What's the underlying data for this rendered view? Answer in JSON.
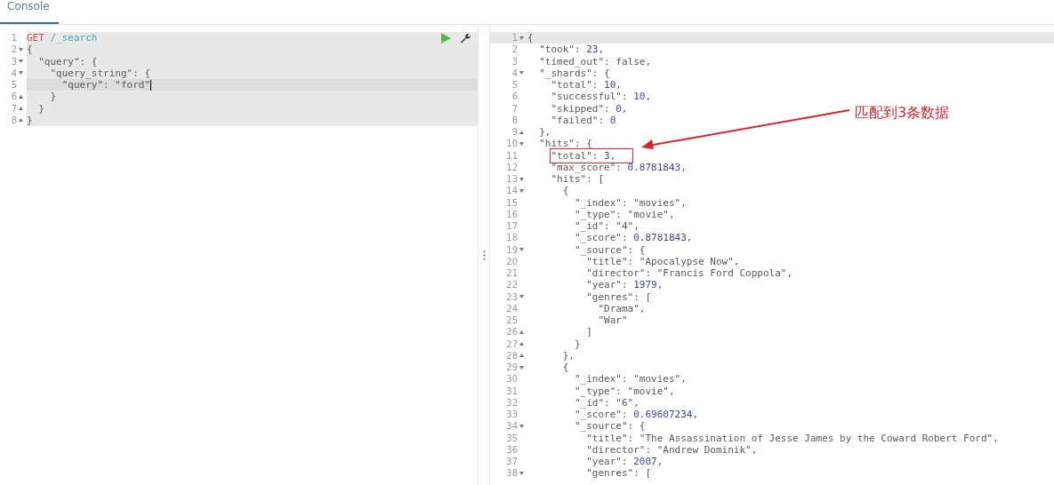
{
  "tabs": [
    {
      "label": "Console",
      "selected": true
    }
  ],
  "request": {
    "lines": [
      {
        "number": "1",
        "kind": "request",
        "method": "GET",
        "path": "/_search",
        "fold_start": false,
        "fold_end": false,
        "active": false
      },
      {
        "number": "2",
        "text": "{",
        "fold_start": true,
        "fold_end": false,
        "active": false
      },
      {
        "number": "3",
        "text": "  \"query\": {",
        "fold_start": true,
        "fold_end": false,
        "active": false
      },
      {
        "number": "4",
        "text": "    \"query_string\": {",
        "fold_start": true,
        "fold_end": false,
        "active": false
      },
      {
        "number": "5",
        "text": "      \"query\": \"ford\"",
        "fold_start": false,
        "fold_end": false,
        "active": true
      },
      {
        "number": "6",
        "text": "    }",
        "fold_start": false,
        "fold_end": true,
        "active": false
      },
      {
        "number": "7",
        "text": "  }",
        "fold_start": false,
        "fold_end": true,
        "active": false
      },
      {
        "number": "8",
        "text": "}",
        "fold_start": false,
        "fold_end": true,
        "active": false
      }
    ]
  },
  "response": {
    "lines": [
      {
        "number": "1",
        "text": "{",
        "fold_start": true,
        "fold_end": false
      },
      {
        "number": "2",
        "text": "  \"took\": 23,",
        "fold_start": false,
        "fold_end": false
      },
      {
        "number": "3",
        "text": "  \"timed_out\": false,",
        "fold_start": false,
        "fold_end": false
      },
      {
        "number": "4",
        "text": "  \"_shards\": {",
        "fold_start": true,
        "fold_end": false
      },
      {
        "number": "5",
        "text": "    \"total\": 10,",
        "fold_start": false,
        "fold_end": false
      },
      {
        "number": "6",
        "text": "    \"successful\": 10,",
        "fold_start": false,
        "fold_end": false
      },
      {
        "number": "7",
        "text": "    \"skipped\": 0,",
        "fold_start": false,
        "fold_end": false
      },
      {
        "number": "8",
        "text": "    \"failed\": 0",
        "fold_start": false,
        "fold_end": false
      },
      {
        "number": "9",
        "text": "  },",
        "fold_start": false,
        "fold_end": true
      },
      {
        "number": "10",
        "text": "  \"hits\": {",
        "fold_start": true,
        "fold_end": false
      },
      {
        "number": "11",
        "text": "    \"total\": 3,",
        "fold_start": false,
        "fold_end": false,
        "boxed": true
      },
      {
        "number": "12",
        "text": "    \"max_score\": 0.8781843,",
        "fold_start": false,
        "fold_end": false
      },
      {
        "number": "13",
        "text": "    \"hits\": [",
        "fold_start": true,
        "fold_end": false
      },
      {
        "number": "14",
        "text": "      {",
        "fold_start": true,
        "fold_end": false
      },
      {
        "number": "15",
        "text": "        \"_index\": \"movies\",",
        "fold_start": false,
        "fold_end": false
      },
      {
        "number": "16",
        "text": "        \"_type\": \"movie\",",
        "fold_start": false,
        "fold_end": false
      },
      {
        "number": "17",
        "text": "        \"_id\": \"4\",",
        "fold_start": false,
        "fold_end": false
      },
      {
        "number": "18",
        "text": "        \"_score\": 0.8781843,",
        "fold_start": false,
        "fold_end": false
      },
      {
        "number": "19",
        "text": "        \"_source\": {",
        "fold_start": true,
        "fold_end": false
      },
      {
        "number": "20",
        "text": "          \"title\": \"Apocalypse Now\",",
        "fold_start": false,
        "fold_end": false
      },
      {
        "number": "21",
        "text": "          \"director\": \"Francis Ford Coppola\",",
        "fold_start": false,
        "fold_end": false
      },
      {
        "number": "22",
        "text": "          \"year\": 1979,",
        "fold_start": false,
        "fold_end": false
      },
      {
        "number": "23",
        "text": "          \"genres\": [",
        "fold_start": true,
        "fold_end": false
      },
      {
        "number": "24",
        "text": "            \"Drama\",",
        "fold_start": false,
        "fold_end": false
      },
      {
        "number": "25",
        "text": "            \"War\"",
        "fold_start": false,
        "fold_end": false
      },
      {
        "number": "26",
        "text": "          ]",
        "fold_start": false,
        "fold_end": true
      },
      {
        "number": "27",
        "text": "        }",
        "fold_start": false,
        "fold_end": true
      },
      {
        "number": "28",
        "text": "      },",
        "fold_start": false,
        "fold_end": true
      },
      {
        "number": "29",
        "text": "      {",
        "fold_start": true,
        "fold_end": false
      },
      {
        "number": "30",
        "text": "        \"_index\": \"movies\",",
        "fold_start": false,
        "fold_end": false
      },
      {
        "number": "31",
        "text": "        \"_type\": \"movie\",",
        "fold_start": false,
        "fold_end": false
      },
      {
        "number": "32",
        "text": "        \"_id\": \"6\",",
        "fold_start": false,
        "fold_end": false
      },
      {
        "number": "33",
        "text": "        \"_score\": 0.69607234,",
        "fold_start": false,
        "fold_end": false
      },
      {
        "number": "34",
        "text": "        \"_source\": {",
        "fold_start": true,
        "fold_end": false
      },
      {
        "number": "35",
        "text": "          \"title\": \"The Assassination of Jesse James by the Coward Robert Ford\",",
        "fold_start": false,
        "fold_end": false
      },
      {
        "number": "36",
        "text": "          \"director\": \"Andrew Dominik\",",
        "fold_start": false,
        "fold_end": false
      },
      {
        "number": "37",
        "text": "          \"year\": 2007,",
        "fold_start": false,
        "fold_end": false
      },
      {
        "number": "38",
        "text": "          \"genres\": [",
        "fold_start": true,
        "fold_end": false
      }
    ]
  },
  "annotation": {
    "note": "匹配到3条数据"
  }
}
